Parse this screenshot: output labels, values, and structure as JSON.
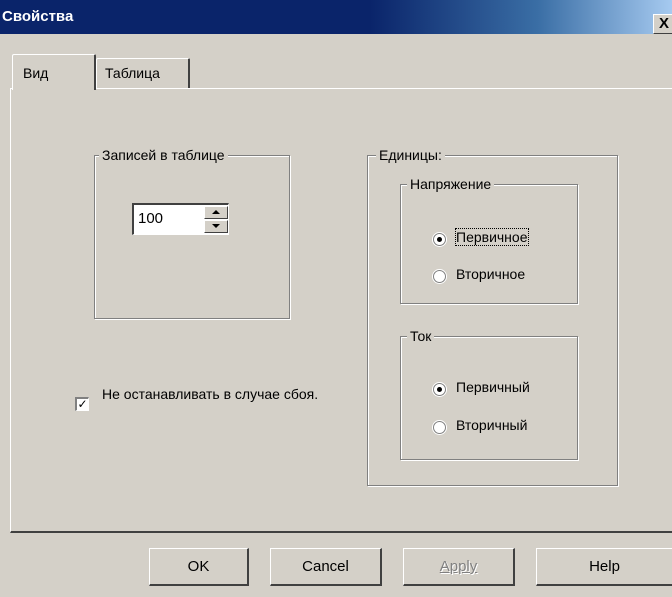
{
  "window": {
    "title": "Свойства",
    "close_label": "X"
  },
  "tabs": [
    {
      "label": "Вид",
      "active": true
    },
    {
      "label": "Таблица",
      "active": false
    }
  ],
  "records_group": {
    "title": "Записей в таблице",
    "value": "100"
  },
  "options": {
    "stop_on_error_label": "Не останавливать в случае сбоя.",
    "checked": true
  },
  "units": {
    "title": "Единицы:",
    "voltage": {
      "title": "Напряжение",
      "options": [
        {
          "label": "Первичное",
          "selected": true
        },
        {
          "label": "Вторичное",
          "selected": false
        }
      ]
    },
    "current": {
      "title": "Ток",
      "options": [
        {
          "label": "Первичный",
          "selected": true
        },
        {
          "label": "Вторичный",
          "selected": false
        }
      ]
    }
  },
  "buttons": {
    "ok": "OK",
    "cancel": "Cancel",
    "apply": "Apply",
    "help": "Help"
  },
  "colors": {
    "face": "#d4d0c8",
    "title_bar": "#0a246a",
    "disabled_text": "#808080"
  }
}
